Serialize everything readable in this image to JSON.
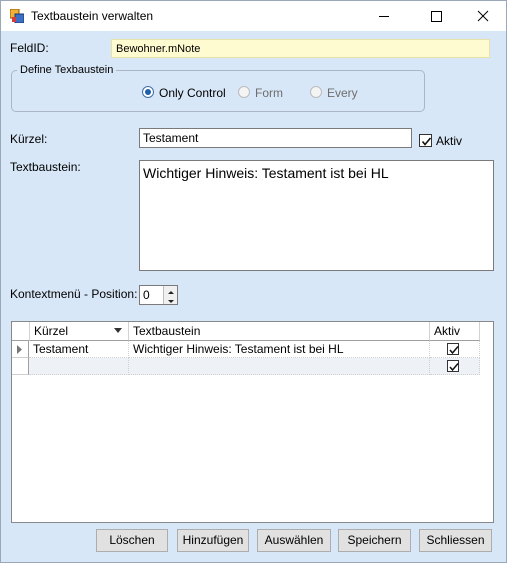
{
  "window": {
    "title": "Textbaustein verwalten"
  },
  "feld": {
    "label": "FeldID:",
    "value": "Bewohner.mNote"
  },
  "define": {
    "title": "Define Texbaustein",
    "options": [
      {
        "label": "Only Control",
        "checked": true
      },
      {
        "label": "Form",
        "checked": false
      },
      {
        "label": "Every",
        "checked": false
      }
    ]
  },
  "kuerzel": {
    "label": "Kürzel:",
    "value": "Testament",
    "aktiv_label": "Aktiv",
    "aktiv_checked": true
  },
  "textbaustein": {
    "label": "Textbaustein:",
    "value": "Wichtiger Hinweis: Testament ist bei HL"
  },
  "kontext": {
    "label": "Kontextmenü - Position:",
    "value": "0"
  },
  "grid": {
    "columns": [
      "Kürzel",
      "Textbaustein",
      "Aktiv"
    ],
    "rows": [
      {
        "kuerzel": "Testament",
        "textbaustein": "Wichtiger Hinweis: Testament ist bei HL",
        "aktiv": true
      },
      {
        "kuerzel": "",
        "textbaustein": "",
        "aktiv": true
      }
    ]
  },
  "buttons": {
    "loeschen": "Löschen",
    "hinzufuegen": "Hinzufügen",
    "auswaehlen": "Auswählen",
    "speichern": "Speichern",
    "schliessen": "Schliessen"
  }
}
